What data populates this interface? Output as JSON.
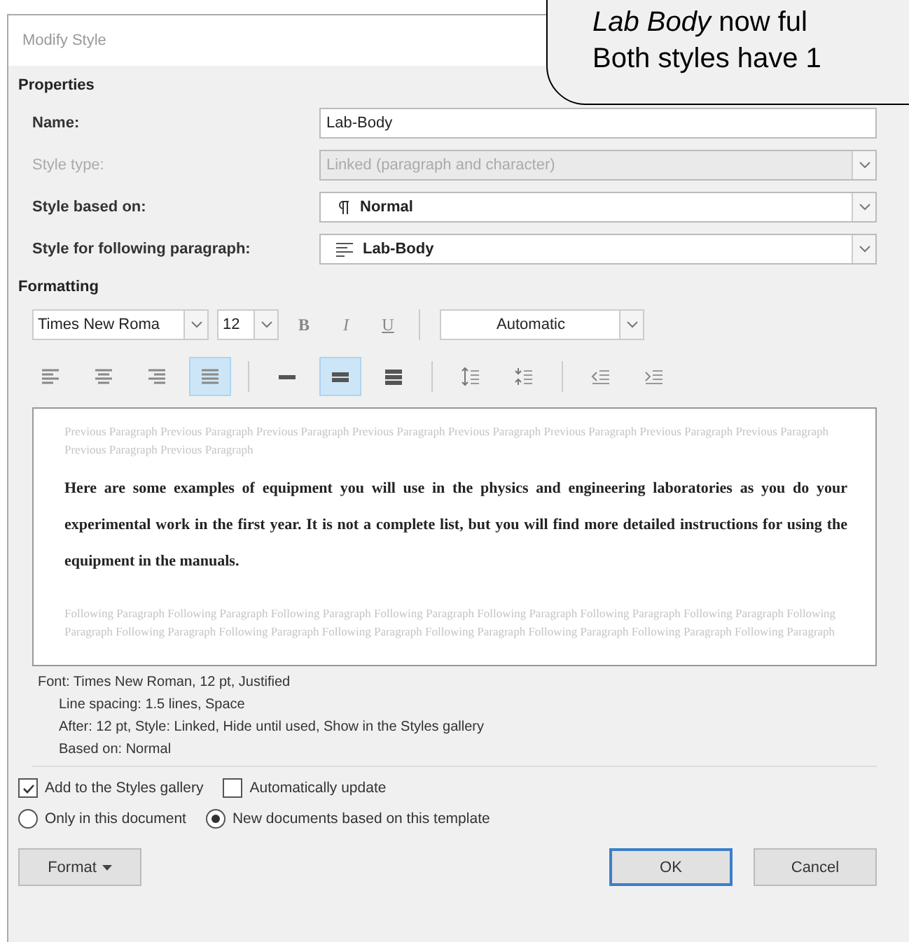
{
  "window": {
    "title": "Modify Style"
  },
  "callout": {
    "lines": [
      "*Lab Body* now ful",
      "Both styles have 1"
    ]
  },
  "properties": {
    "heading": "Properties",
    "rows": [
      {
        "kind": "text",
        "label": "Name:",
        "value": "Lab-Body",
        "disabled": false
      },
      {
        "kind": "select",
        "label": "Style type:",
        "value": "Linked (paragraph and character)",
        "disabled": true
      },
      {
        "kind": "select",
        "label": "Style based on:",
        "value": "Normal",
        "disabled": false
      },
      {
        "kind": "select",
        "label": "Style for following paragraph:",
        "value": "Lab-Body",
        "disabled": false
      }
    ]
  },
  "formatting": {
    "heading": "Formatting",
    "font": "Times New Roma",
    "size": "12",
    "styles": [
      {
        "label": "B",
        "kind": "bold",
        "selected": false
      },
      {
        "label": "I",
        "kind": "italic",
        "selected": false
      },
      {
        "label": "U",
        "kind": "underline",
        "selected": false
      }
    ],
    "font_color": "Automatic",
    "paragraph_buttons": [
      {
        "kind": "align-left",
        "selected": false
      },
      {
        "kind": "align-center",
        "selected": false
      },
      {
        "kind": "align-right",
        "selected": false
      },
      {
        "kind": "justify",
        "selected": true
      },
      {
        "kind": "single-spacing",
        "selected": false
      },
      {
        "kind": "one-half-spacing",
        "selected": true
      },
      {
        "kind": "double-spacing",
        "selected": false
      },
      {
        "kind": "increase-spacing",
        "selected": false
      },
      {
        "kind": "decrease-spacing",
        "selected": false
      },
      {
        "kind": "decrease-indent",
        "selected": false
      },
      {
        "kind": "increase-indent",
        "selected": false
      }
    ]
  },
  "preview": {
    "previous": "Previous Paragraph Previous Paragraph Previous Paragraph Previous Paragraph Previous Paragraph Previous Paragraph Previous Paragraph Previous Paragraph Previous Paragraph Previous Paragraph",
    "sample": "Here are some examples of equipment you will use in the physics and engineering laboratories as you do your experimental work in the first year. It is not a complete list, but you will find more detailed instructions for using the equipment in the manuals.",
    "following": "Following Paragraph Following Paragraph Following Paragraph Following Paragraph Following Paragraph Following Paragraph Following Paragraph Following Paragraph Following Paragraph Following Paragraph Following Paragraph Following Paragraph Following Paragraph Following Paragraph Following Paragraph"
  },
  "description": [
    "Font: Times New Roman, 12 pt, Justified",
    "Line spacing:  1.5 lines, Space",
    "After:  12 pt, Style: Linked, Hide until used, Show in the Styles gallery",
    "Based on: Normal"
  ],
  "options": [
    {
      "label": "Add to the Styles gallery",
      "checked": true
    },
    {
      "label": "Automatically update",
      "checked": false
    }
  ],
  "scope": [
    {
      "label": "Only in this document",
      "selected": false
    },
    {
      "label": "New documents based on this template",
      "selected": true
    }
  ],
  "buttons": [
    {
      "label": "Format",
      "kind": "menu",
      "default": false
    },
    {
      "label": "OK",
      "kind": "plain",
      "default": true
    },
    {
      "label": "Cancel",
      "kind": "plain",
      "default": false
    }
  ]
}
